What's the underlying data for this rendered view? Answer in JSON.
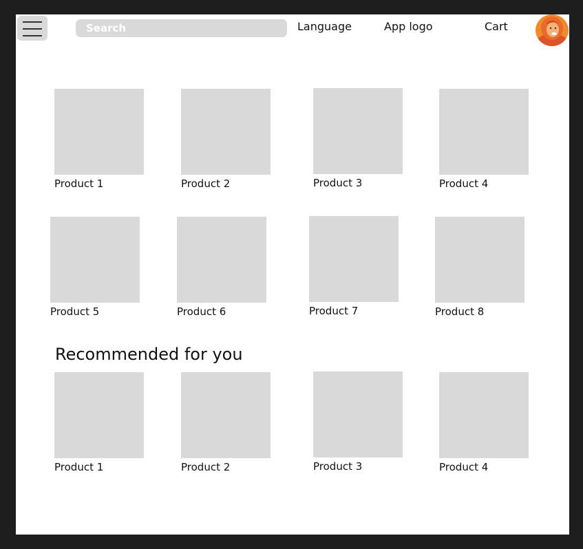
{
  "header": {
    "search_placeholder": "Search",
    "language_label": "Language",
    "logo_label": "App logo",
    "cart_label": "Cart"
  },
  "products": [
    {
      "label": "Product 1"
    },
    {
      "label": "Product 2"
    },
    {
      "label": "Product 3"
    },
    {
      "label": "Product 4"
    },
    {
      "label": "Product 5"
    },
    {
      "label": "Product 6"
    },
    {
      "label": "Product 7"
    },
    {
      "label": "Product 8"
    }
  ],
  "recommended": {
    "title": "Recommended for you",
    "items": [
      {
        "label": "Product 1"
      },
      {
        "label": "Product 2"
      },
      {
        "label": "Product 3"
      },
      {
        "label": "Product 4"
      }
    ]
  }
}
